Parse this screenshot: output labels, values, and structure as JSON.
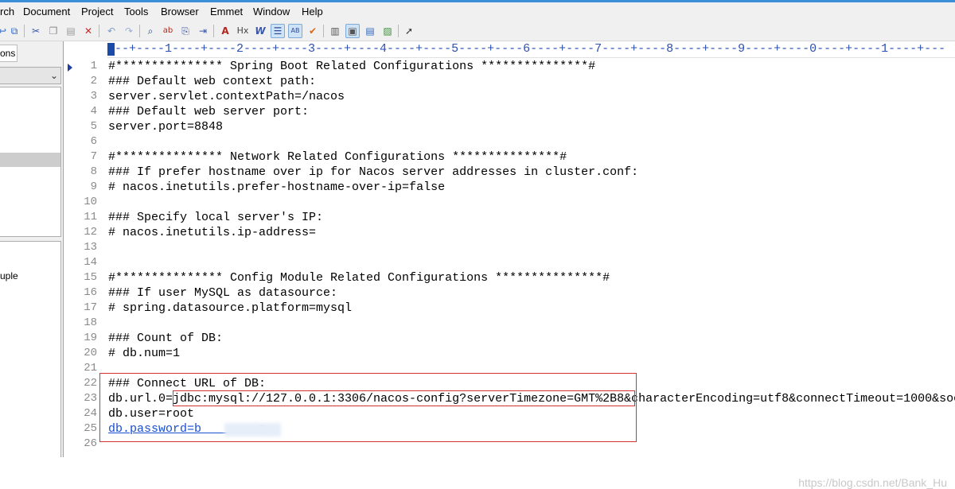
{
  "menu": [
    "rch",
    "Document",
    "Project",
    "Tools",
    "Browser",
    "Emmet",
    "Window",
    "Help"
  ],
  "toolbar_icons": [
    "undo-arrow-icon",
    "view-icon",
    "cut-icon",
    "copy-icon",
    "paste-icon",
    "delete-icon",
    "undo-icon",
    "redo-icon",
    "find-icon",
    "replace-icon",
    "find-in-files-icon",
    "jump-icon",
    "font-size-icon",
    "heading-icon",
    "italic-w-icon",
    "word-wrap-icon",
    "spell-abcd-icon",
    "check-icon",
    "panel-left-icon",
    "panel-toggle-icon",
    "panel-list-icon",
    "panel-image-icon",
    "pointer-help-icon"
  ],
  "left_panel": {
    "tab_label": "ons",
    "list_item": "uple"
  },
  "editor": {
    "ruler": "---+----1----+----2----+----3----+----4----+----5----+----6----+----7----+----8----+----9----+----0----+----1----+---",
    "lines": [
      "#*************** Spring Boot Related Configurations ***************#",
      "### Default web context path:",
      "server.servlet.contextPath=/nacos",
      "### Default web server port:",
      "server.port=8848",
      "",
      "#*************** Network Related Configurations ***************#",
      "### If prefer hostname over ip for Nacos server addresses in cluster.conf:",
      "# nacos.inetutils.prefer-hostname-over-ip=false",
      "",
      "### Specify local server's IP:",
      "# nacos.inetutils.ip-address=",
      "",
      "",
      "#*************** Config Module Related Configurations ***************#",
      "### If user MySQL as datasource:",
      "# spring.datasource.platform=mysql",
      "",
      "### Count of DB:",
      "# db.num=1",
      "",
      "### Connect URL of DB:",
      "db.url.0=jdbc:mysql://127.0.0.1:3306/nacos-config?serverTimezone=GMT%2B8&characterEncoding=utf8&connectTimeout=1000&soc",
      "db.user=root",
      "db.password=b        m",
      ""
    ]
  },
  "watermark": "https://blog.csdn.net/Bank_Hu",
  "colors": {
    "accent_blue": "#3b8fd9",
    "highlight_red": "#d93030",
    "line_number": "#8a8a8a",
    "link": "#1a4fd1"
  }
}
